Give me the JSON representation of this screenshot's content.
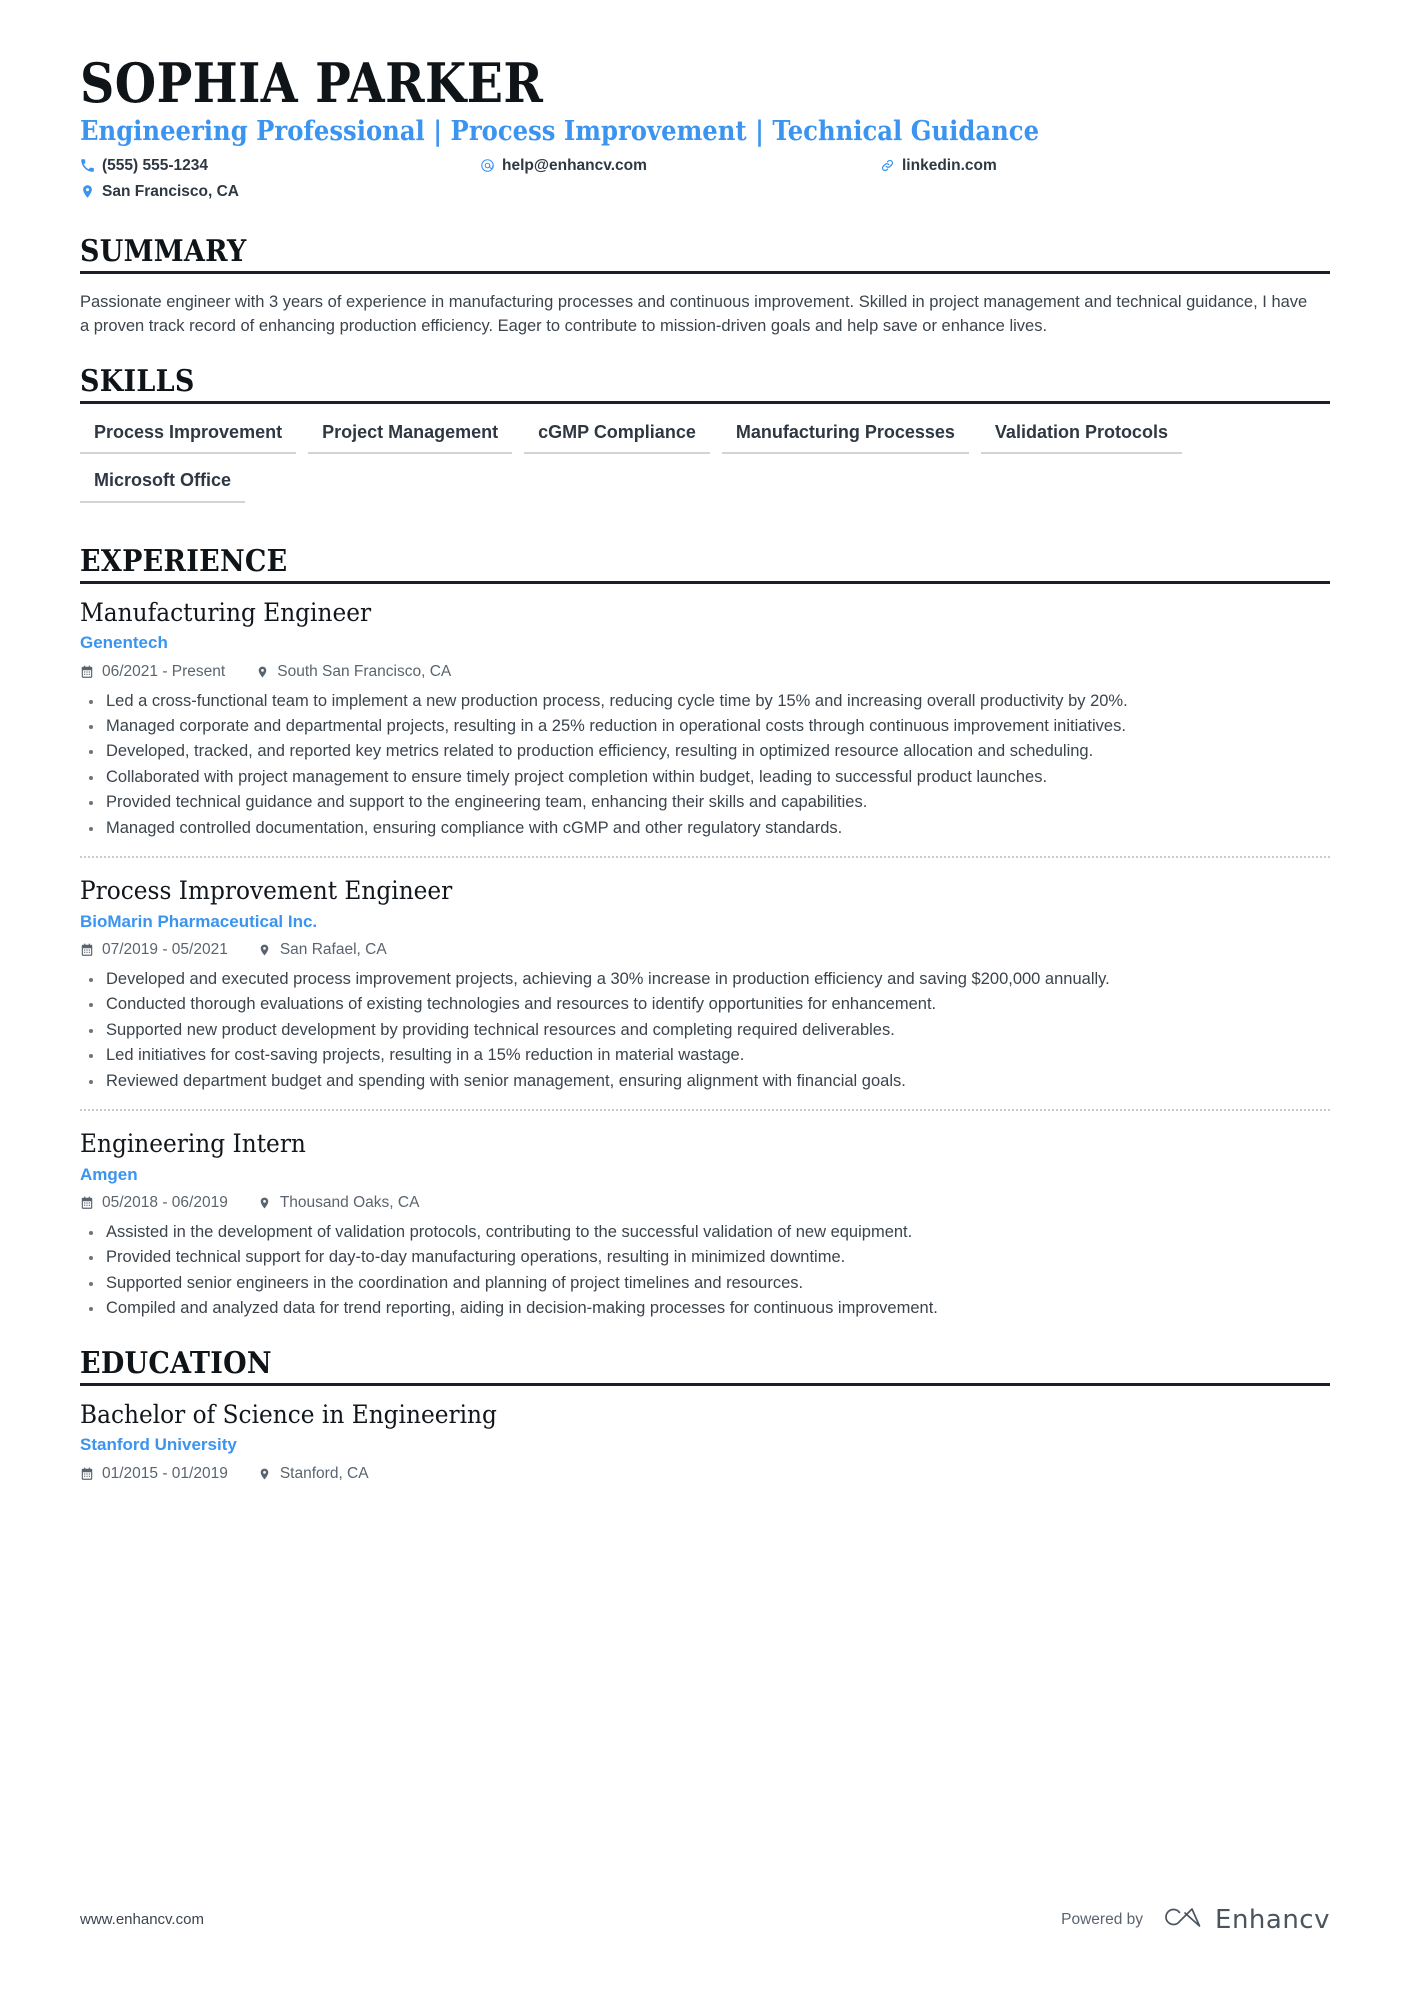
{
  "header": {
    "name": "SOPHIA PARKER",
    "headline": "Engineering Professional | Process Improvement | Technical Guidance",
    "contacts": [
      {
        "icon": "phone-icon",
        "text": "(555) 555-1234"
      },
      {
        "icon": "email-at-icon",
        "text": "help@enhancv.com"
      },
      {
        "icon": "link-icon",
        "text": "linkedin.com"
      },
      {
        "icon": "location-pin-icon",
        "text": "San Francisco, CA"
      }
    ]
  },
  "sections": {
    "summary": {
      "title": "SUMMARY",
      "text": "Passionate engineer with 3 years of experience in manufacturing processes and continuous improvement. Skilled in project management and technical guidance, I have a proven track record of enhancing production efficiency. Eager to contribute to mission-driven goals and help save or enhance lives."
    },
    "skills": {
      "title": "SKILLS",
      "items": [
        "Process Improvement",
        "Project Management",
        "cGMP Compliance",
        "Manufacturing Processes",
        "Validation Protocols",
        "Microsoft Office"
      ]
    },
    "experience": {
      "title": "EXPERIENCE",
      "entries": [
        {
          "title": "Manufacturing Engineer",
          "org": "Genentech",
          "dates": "06/2021 - Present",
          "location": "South San Francisco, CA",
          "bullets": [
            "Led a cross-functional team to implement a new production process, reducing cycle time by 15% and increasing overall productivity by 20%.",
            "Managed corporate and departmental projects, resulting in a 25% reduction in operational costs through continuous improvement initiatives.",
            "Developed, tracked, and reported key metrics related to production efficiency, resulting in optimized resource allocation and scheduling.",
            "Collaborated with project management to ensure timely project completion within budget, leading to successful product launches.",
            "Provided technical guidance and support to the engineering team, enhancing their skills and capabilities.",
            "Managed controlled documentation, ensuring compliance with cGMP and other regulatory standards."
          ]
        },
        {
          "title": "Process Improvement Engineer",
          "org": "BioMarin Pharmaceutical Inc.",
          "dates": "07/2019 - 05/2021",
          "location": "San Rafael, CA",
          "bullets": [
            "Developed and executed process improvement projects, achieving a 30% increase in production efficiency and saving $200,000 annually.",
            "Conducted thorough evaluations of existing technologies and resources to identify opportunities for enhancement.",
            "Supported new product development by providing technical resources and completing required deliverables.",
            "Led initiatives for cost-saving projects, resulting in a 15% reduction in material wastage.",
            "Reviewed department budget and spending with senior management, ensuring alignment with financial goals."
          ]
        },
        {
          "title": "Engineering Intern",
          "org": "Amgen",
          "dates": "05/2018 - 06/2019",
          "location": "Thousand Oaks, CA",
          "bullets": [
            "Assisted in the development of validation protocols, contributing to the successful validation of new equipment.",
            "Provided technical support for day-to-day manufacturing operations, resulting in minimized downtime.",
            "Supported senior engineers in the coordination and planning of project timelines and resources.",
            "Compiled and analyzed data for trend reporting, aiding in decision-making processes for continuous improvement."
          ]
        }
      ]
    },
    "education": {
      "title": "EDUCATION",
      "entries": [
        {
          "title": "Bachelor of Science in Engineering",
          "org": "Stanford University",
          "dates": "01/2015 - 01/2019",
          "location": "Stanford, CA"
        }
      ]
    }
  },
  "footer": {
    "url": "www.enhancv.com",
    "powered_by": "Powered by",
    "brand": "Enhancv",
    "brand_logo_icon": "enhancv-loop-logo-icon"
  },
  "colors": {
    "accent_blue": "#3a94f0",
    "text_dark": "#2e3842",
    "text_body": "#3b444d",
    "text_muted": "#5a646e",
    "rule_dark": "#1b2026",
    "skill_underline": "#cfd4d9"
  }
}
